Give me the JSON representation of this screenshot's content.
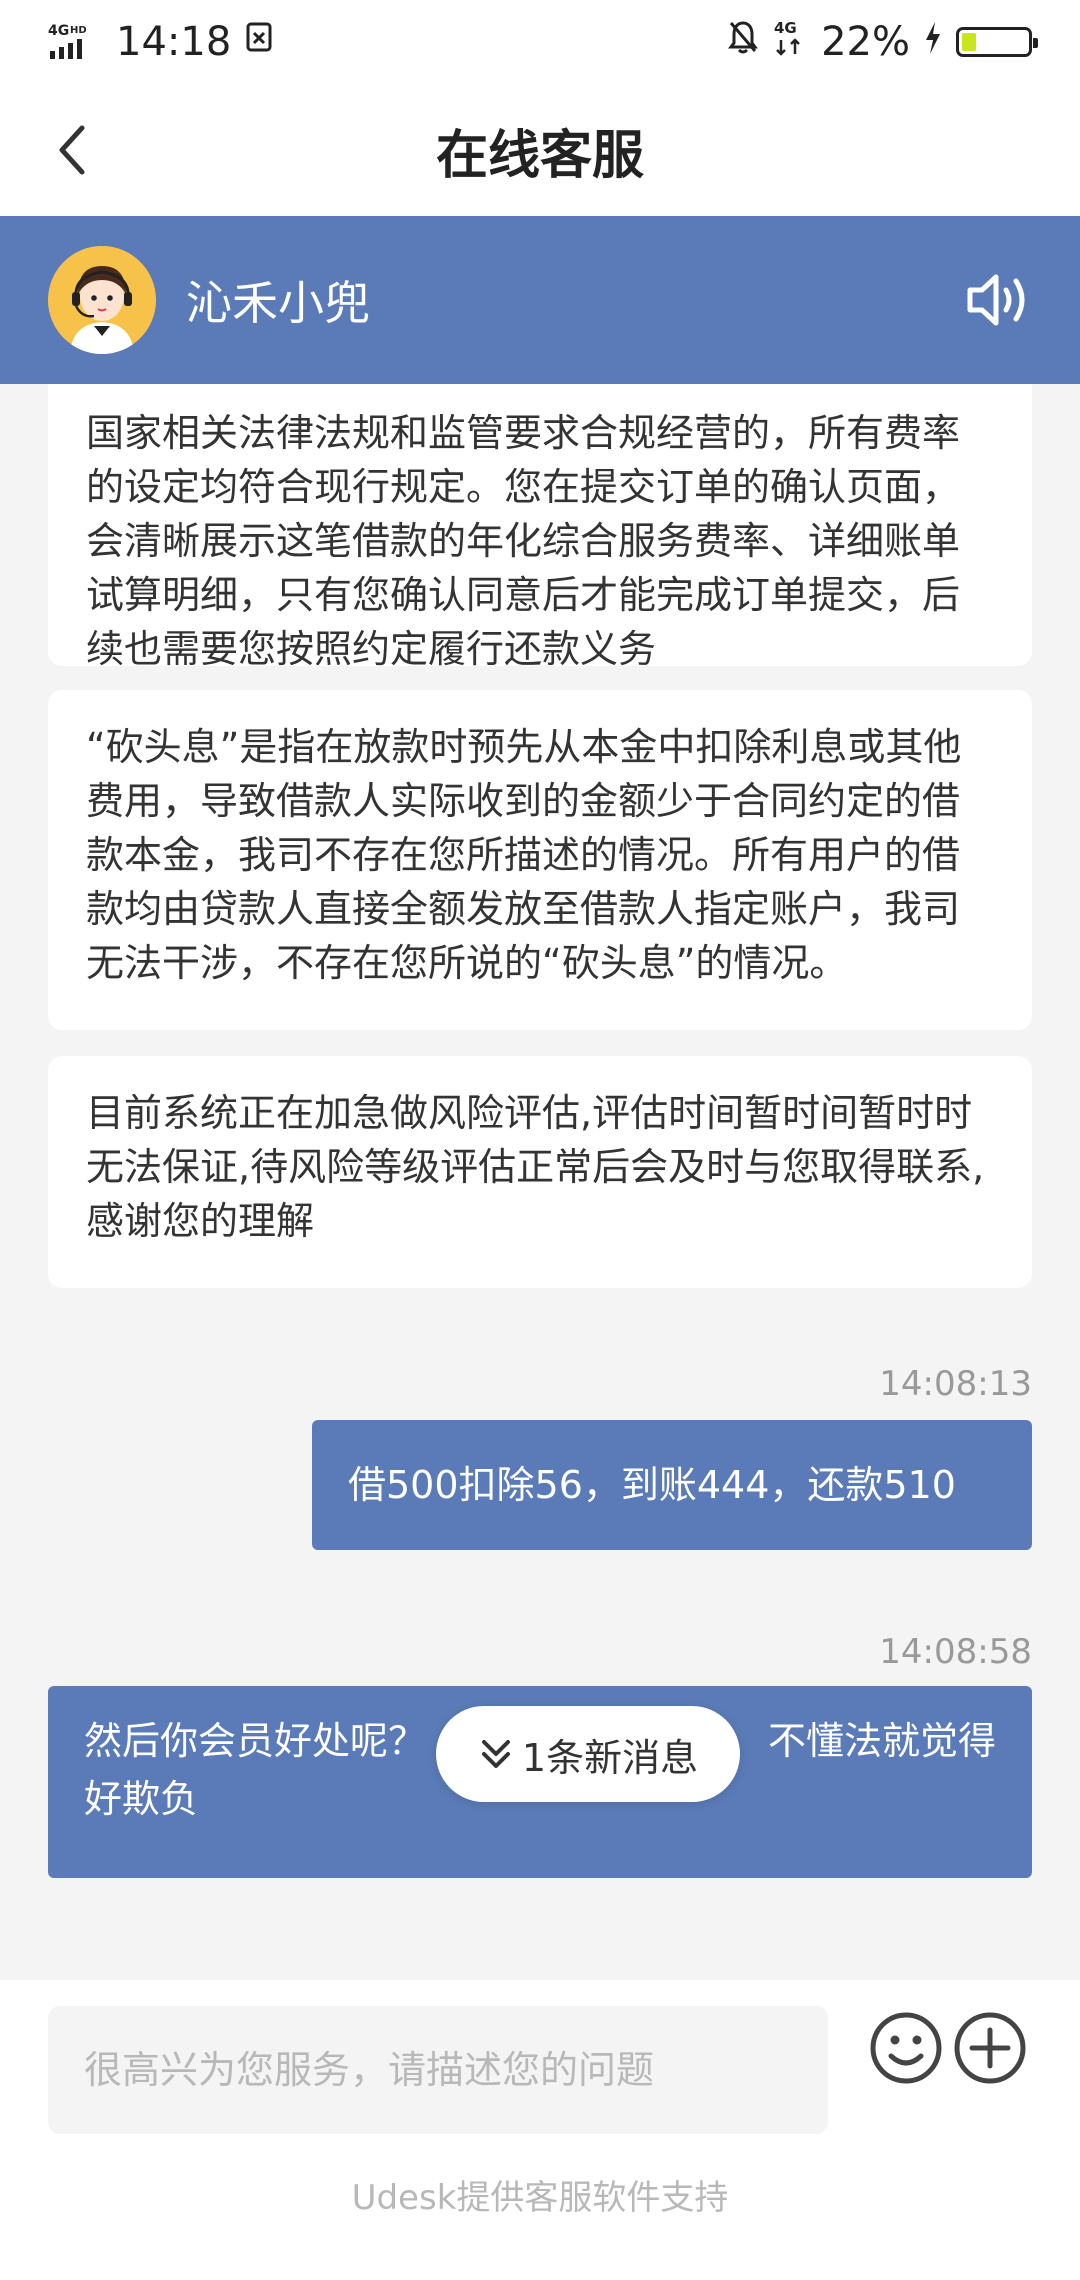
{
  "status_bar": {
    "network_left": "4G",
    "network_hd": "HD",
    "time": "14:18",
    "network_right": "4G",
    "battery": "22%",
    "battery_level": 0.22,
    "battery_color": "#c8e51f"
  },
  "header": {
    "title": "在线客服"
  },
  "agent": {
    "name": "沁禾小兜",
    "bar_color": "#5b7bb8"
  },
  "messages": [
    {
      "direction": "in",
      "text": "国家相关法律法规和监管要求合规经营的，所有费率的设定均符合现行规定。您在提交订单的确认页面，会清晰展示这笔借款的年化综合服务费率、详细账单试算明细，只有您确认同意后才能完成订单提交，后续也需要您按照约定履行还款义务"
    },
    {
      "direction": "in",
      "text": "“砍头息”是指在放款时预先从本金中扣除利息或其他费用，导致借款人实际收到的金额少于合同约定的借款本金，我司不存在您所描述的情况。所有用户的借款均由贷款人直接全额发放至借款人指定账户，我司无法干涉，不存在您所说的“砍头息”的情况。"
    },
    {
      "direction": "in",
      "text": "目前系统正在加急做风险评估,评估时间暂时间暂时时无法保证,待风险等级评估正常后会及时与您取得联系,感谢您的理解"
    },
    {
      "direction": "out",
      "time": "14:08:13",
      "text": "借500扣除56，到账444，还款510"
    },
    {
      "direction": "out",
      "time": "14:08:58",
      "text_part1": "然后你会员好处呢？",
      "text_part2": "不懂法就觉得",
      "text_part3": "好欺负"
    }
  ],
  "new_message_pill": {
    "label": "1条新消息"
  },
  "input": {
    "placeholder": "很高兴为您服务，请描述您的问题"
  },
  "footer": {
    "powered_by": "Udesk提供客服软件支持"
  },
  "icons": {
    "back": "chevron-left-icon",
    "speaker": "speaker-icon",
    "emoji": "smiley-icon",
    "plus": "plus-circle-icon",
    "new_msg": "double-chevron-down-icon"
  }
}
